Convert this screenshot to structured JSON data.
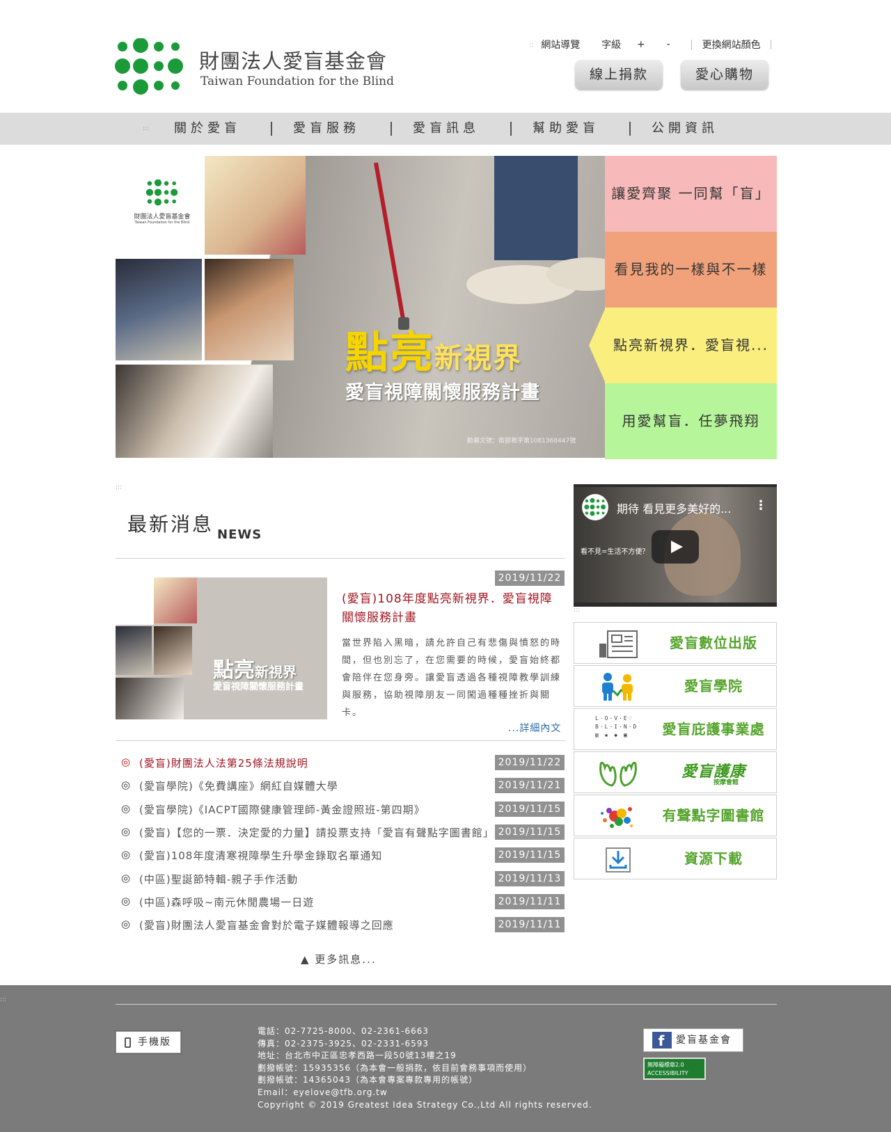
{
  "header": {
    "logo_cn": "財團法人愛盲基金會",
    "logo_en": "Taiwan Foundation for the Blind",
    "sitemap_label": "網站導覽",
    "fontsize_label": "字級",
    "font_plus": "+",
    "font_minus": "-",
    "color_label": "更換網站顏色",
    "donate_label": "線上捐款",
    "shop_label": "愛心購物"
  },
  "nav": {
    "items": [
      "關於愛盲",
      "愛盲服務",
      "愛盲訊息",
      "幫助愛盲",
      "公開資訊"
    ]
  },
  "banner": {
    "mini_logo_cn": "財團法人愛盲基金會",
    "mini_logo_en": "Taiwan Foundation for the Blind",
    "headline_big": "點亮",
    "headline_small": "新視界",
    "subline": "愛盲視障關懷服務計畫",
    "tiny": "勸募文號：衛部救字第1081368447號",
    "tabs": [
      {
        "label": "讓愛齊聚 一同幫「盲」",
        "color": "#f7b9b9"
      },
      {
        "label": "看見我的一樣與不一樣",
        "color": "#f2a27a"
      },
      {
        "label": "點亮新視界．愛盲視...",
        "color": "#f9ee7e"
      },
      {
        "label": "用愛幫盲．任夢飛翔",
        "color": "#b7f59a"
      }
    ]
  },
  "news": {
    "title": "最新消息",
    "subtitle": "NEWS",
    "featured": {
      "date": "2019/11/22",
      "title": "(愛盲)108年度點亮新視界．愛盲視障關懷服務計畫",
      "img_headline_big": "點亮",
      "img_headline_small": "新視界",
      "img_subline": "愛盲視障關懷服務計畫",
      "body": "當世界陷入黑暗，請允許自己有悲傷與憤怒的時間，但也別忘了，在您需要的時候，愛盲始終都會陪伴在您身旁。讓愛盲透過各種視障教學訓練與服務，協助視障朋友一同闖過種種挫折與關卡。",
      "more": "...詳細內文"
    },
    "items": [
      {
        "text": "(愛盲)財團法人法第25條法規說明",
        "date": "2019/11/22",
        "highlight": true
      },
      {
        "text": "(愛盲學院)《免費講座》網紅自媒體大學",
        "date": "2019/11/21",
        "highlight": false
      },
      {
        "text": "(愛盲學院)《IACPT國際健康管理師-黃金證照班-第四期》",
        "date": "2019/11/15",
        "highlight": false
      },
      {
        "text": "(愛盲)【您的一票．決定愛的力量】請投票支持「愛盲有聲點字圖書館」",
        "date": "2019/11/15",
        "highlight": false
      },
      {
        "text": "(愛盲)108年度清寒視障學生升學金錄取名單通知",
        "date": "2019/11/15",
        "highlight": false
      },
      {
        "text": "(中區)聖誕節特輯-親子手作活動",
        "date": "2019/11/13",
        "highlight": false
      },
      {
        "text": "(中區)森呼吸~南元休閒農場一日遊",
        "date": "2019/11/11",
        "highlight": false
      },
      {
        "text": "(愛盲)財團法人愛盲基金會對於電子媒體報導之回應",
        "date": "2019/11/11",
        "highlight": false
      }
    ],
    "bullet": "◎",
    "more_label": "▲ 更多訊息..."
  },
  "video": {
    "title": "期待 看見更多美好的...",
    "caption": "看不見=生活不方便？"
  },
  "side_links": [
    {
      "label": "愛盲數位出版",
      "icon": "publication-icon"
    },
    {
      "label": "愛盲學院",
      "icon": "people-icon"
    },
    {
      "label": "愛盲庇護事業處",
      "icon": "love-blind-icon"
    },
    {
      "label": "愛盲護康",
      "icon": "hands-icon"
    },
    {
      "label": "有聲點字圖書館",
      "icon": "splash-icon"
    },
    {
      "label": "資源下載",
      "icon": "download-icon"
    }
  ],
  "love_blind_icon_text": [
    "L·O·V·E♡",
    "B·L·I·N·D",
    "▥ ▪ ◆ ▣"
  ],
  "hukang_sub": "按摩會館",
  "footer": {
    "mobile_label": "手機版",
    "contact": [
      "電話：02-7725-8000、02-2361-6663",
      "傳真：02-2375-3925、02-2331-6593",
      "地址：台北市中正區忠孝西路一段50號13樓之19",
      "劃撥帳號：15935356（為本會一般捐款，依目前會務事項而使用）",
      "劃撥帳號：14365043（為本會專案專款專用的帳號）",
      "Email：eyelove@tfb.org.tw",
      "Copyright © 2019 Greatest Idea Strategy Co.,Ltd All rights reserved."
    ],
    "fb_letter": "f",
    "fb_label": "愛盲基金會",
    "accessibility_label": "無障礙標章2.0",
    "accessibility_sub": "ACCESSIBILITY"
  },
  "colors": {
    "brand_green": "#1b9a3a",
    "news_red": "#a1141e",
    "link_blue": "#2a6aa8",
    "side_green": "#55a42c"
  }
}
